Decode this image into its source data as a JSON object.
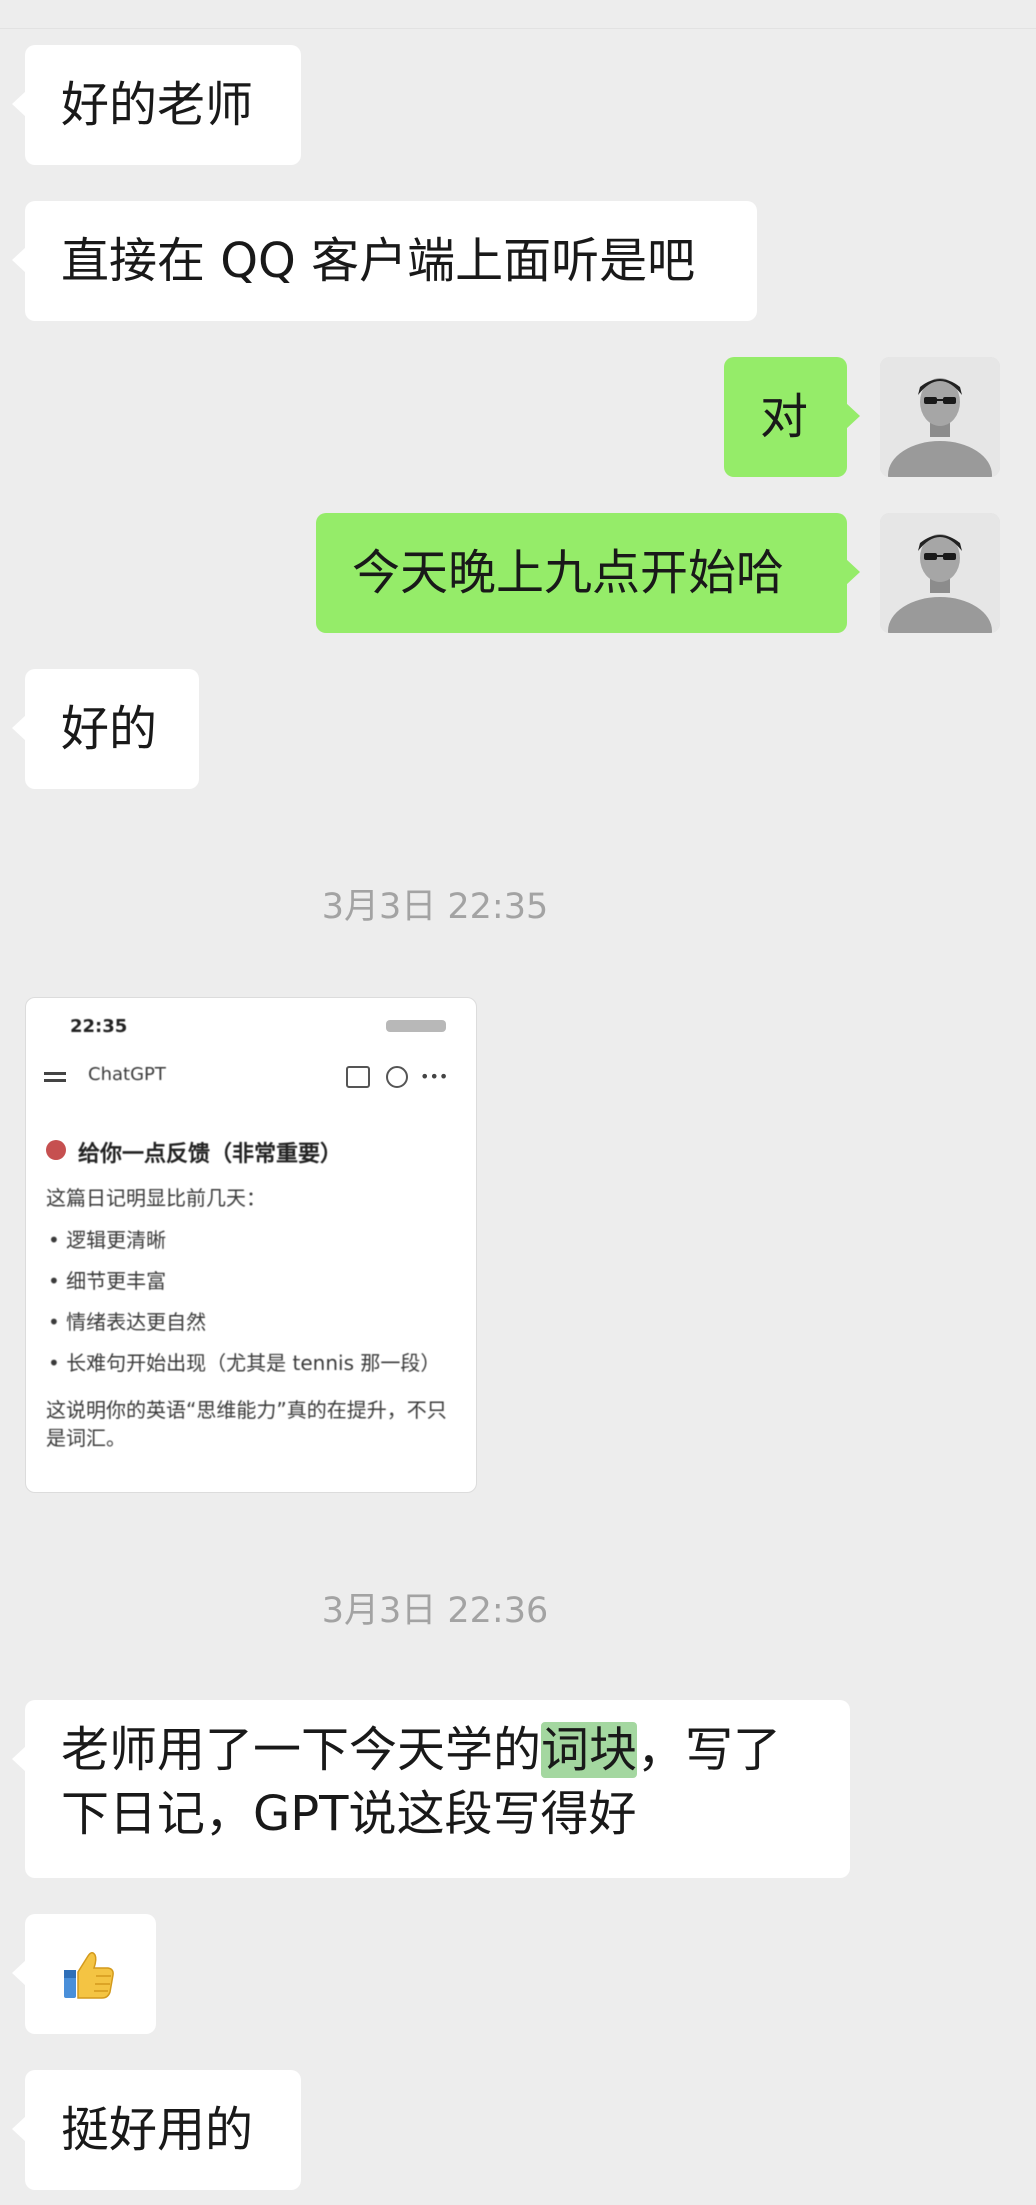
{
  "messages": [
    {
      "side": "in",
      "text": "好的老师"
    },
    {
      "side": "in",
      "text": "直接在 QQ 客户端上面听是吧"
    },
    {
      "side": "out",
      "text": "对"
    },
    {
      "side": "out",
      "text": "今天晚上九点开始哈"
    },
    {
      "side": "in",
      "text": "好的"
    },
    {
      "side": "in",
      "text_line1_a": "老师用了一下今天学的",
      "text_line1_hl": "词块",
      "text_line1_b": "，写了",
      "text_line2": "下日记，GPT说这段写得好"
    },
    {
      "side": "in",
      "emoji": "thumbs-up"
    },
    {
      "side": "in",
      "text": "挺好用的"
    }
  ],
  "timestamps": [
    "3月3日 22:35",
    "3月3日 22:36"
  ],
  "screenshot_thumb": {
    "status_time": "22:35",
    "app_title": "ChatGPT",
    "heading": "给你一点反馈（非常重要）",
    "intro": "这篇日记明显比前几天：",
    "bullets": [
      "逻辑更清晰",
      "细节更丰富",
      "情绪表达更自然",
      "长难句开始出现（尤其是 tennis 那一段）"
    ],
    "closing_line1": "这说明你的英语“思维能力”真的在提升，不只",
    "closing_line2": "是词汇。"
  },
  "colors": {
    "background": "#ededed",
    "incoming": "#ffffff",
    "outgoing": "#95ec69",
    "highlight": "#a4d7a0",
    "timestamp": "#a3a3a3"
  }
}
